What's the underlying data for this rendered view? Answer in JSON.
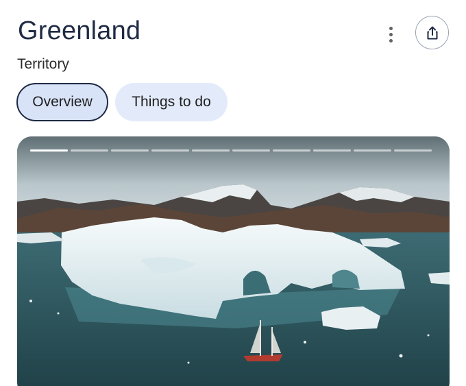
{
  "header": {
    "title": "Greenland",
    "subtitle": "Territory"
  },
  "actions": {
    "more_icon": "more-vert-icon",
    "share_icon": "share-icon"
  },
  "tabs": [
    {
      "label": "Overview",
      "active": true
    },
    {
      "label": "Things to do",
      "active": false
    }
  ],
  "media": {
    "story_segments": 11,
    "current_segment": 1,
    "image_subject": "iceberg-with-sailboat",
    "colors": {
      "sky": "#c9d4d8",
      "water": "#2f5961",
      "ice": "#eef4f6",
      "mountain": "#3e3a38"
    }
  },
  "colors": {
    "title": "#1f2a44",
    "active_tab_bg": "#d8e3f8",
    "inactive_tab_bg": "#e3ebfb",
    "share_border": "#9aa3b2"
  }
}
